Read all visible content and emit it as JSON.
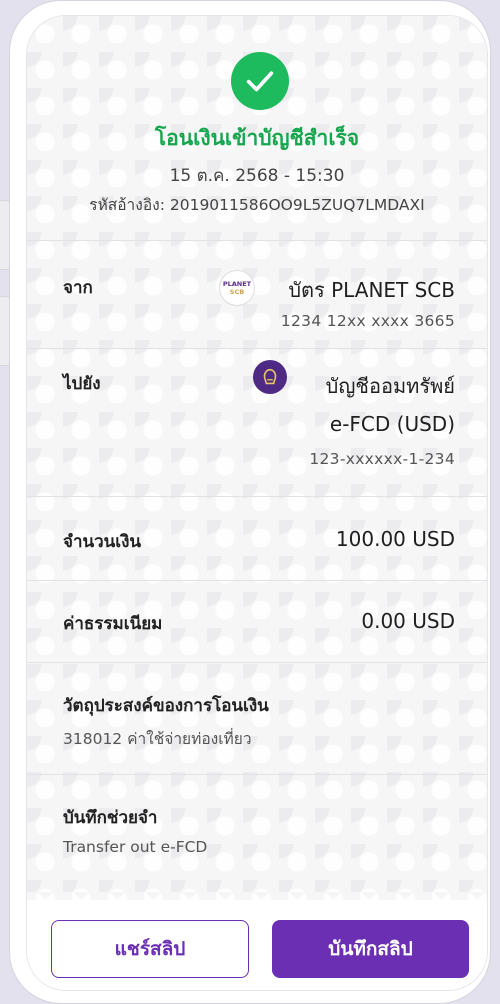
{
  "status": {
    "title": "โอนเงินเข้าบัญชีสำเร็จ",
    "datetime": "15 ต.ค. 2568 - 15:30",
    "reference": "รหัสอ้างอิง: 2019011586OO9L5ZUQ7LMDAXI"
  },
  "from": {
    "label": "จาก",
    "name": "บัตร PLANET SCB",
    "number": "1234 12xx xxxx 3665",
    "logo_line1": "PLANET",
    "logo_line2": "SCB"
  },
  "to": {
    "label": "ไปยัง",
    "name_line1": "บัญชีออมทรัพย์",
    "name_line2": "e-FCD (USD)",
    "number": "123-xxxxxx-1-234"
  },
  "amount": {
    "label": "จำนวนเงิน",
    "value": "100.00 USD"
  },
  "fee": {
    "label": "ค่าธรรมเนียม",
    "value": "0.00 USD"
  },
  "purpose": {
    "label": "วัตถุประสงค์ของการโอนเงิน",
    "value": "318012 ค่าใช้จ่ายท่องเที่ยว"
  },
  "memo": {
    "label": "บันทึกช่วยจำ",
    "value": "Transfer out e-FCD"
  },
  "actions": {
    "share_label": "แชร์สลิป",
    "save_label": "บันทึกสลิป"
  },
  "colors": {
    "success": "#1dbb5d",
    "primary": "#6b2fb3"
  },
  "icons": {
    "status": "check-circle-icon",
    "from_logo": "planet-scb-logo",
    "to_logo": "scb-bank-logo"
  }
}
